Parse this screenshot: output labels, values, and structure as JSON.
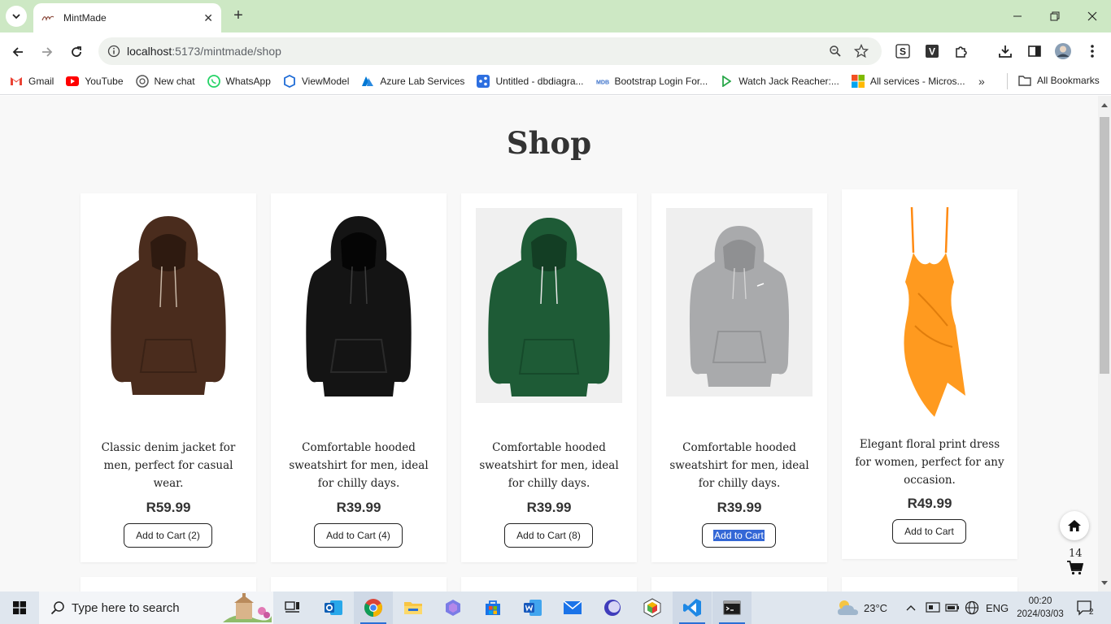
{
  "browser": {
    "tab_title": "MintMade",
    "url_host": "localhost",
    "url_rest": ":5173/mintmade/shop",
    "bookmarks": [
      {
        "label": "Gmail",
        "icon": "gmail-icon"
      },
      {
        "label": "YouTube",
        "icon": "youtube-icon"
      },
      {
        "label": "New chat",
        "icon": "chatgpt-icon"
      },
      {
        "label": "WhatsApp",
        "icon": "whatsapp-icon"
      },
      {
        "label": "ViewModel",
        "icon": "viewmodel-icon"
      },
      {
        "label": "Azure Lab Services",
        "icon": "azure-icon"
      },
      {
        "label": "Untitled - dbdiagra...",
        "icon": "dbdiagram-icon"
      },
      {
        "label": "Bootstrap Login For...",
        "icon": "mdb-icon"
      },
      {
        "label": "Watch Jack Reacher:...",
        "icon": "play-icon"
      },
      {
        "label": "All services - Micros...",
        "icon": "microsoft-icon"
      }
    ],
    "all_bookmarks": "All Bookmarks"
  },
  "page": {
    "title": "Shop",
    "products": [
      {
        "description": "Classic denim jacket for men, perfect for casual wear.",
        "price": "R59.99",
        "button": "Add to Cart (2)",
        "image": "brown-hoodie",
        "color": "#4a2c1d"
      },
      {
        "description": "Comfortable hooded sweatshirt for men, ideal for chilly days.",
        "price": "R39.99",
        "button": "Add to Cart (4)",
        "image": "black-hoodie",
        "color": "#141414"
      },
      {
        "description": "Comfortable hooded sweatshirt for men, ideal for chilly days.",
        "price": "R39.99",
        "button": "Add to Cart (8)",
        "image": "green-hoodie",
        "color": "#1e5b36"
      },
      {
        "description": "Comfortable hooded sweatshirt for men, ideal for chilly days.",
        "price": "R39.99",
        "button": "Add to Cart",
        "image": "grey-hoodie",
        "color": "#a9aaac"
      },
      {
        "description": "Elegant floral print dress for women, perfect for any occasion.",
        "price": "R49.99",
        "button": "Add to Cart",
        "image": "orange-dress",
        "color": "#ff9a1f"
      }
    ],
    "cart_count": "14"
  },
  "taskbar": {
    "search_placeholder": "Type here to search",
    "weather": "23°C",
    "language": "ENG",
    "time": "00:20",
    "date": "2024/03/03",
    "notification_count": "2"
  },
  "colors": {
    "tab_strip": "#cde8c4",
    "page_bg": "#f8f8f8",
    "selection": "#3367d6"
  }
}
